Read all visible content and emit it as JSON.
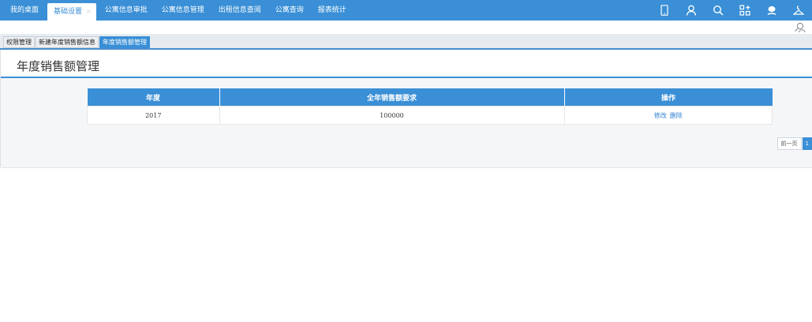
{
  "topnav": {
    "items": [
      {
        "label": "我的桌面"
      },
      {
        "label": "基础设置",
        "active": true,
        "close": "×"
      },
      {
        "label": "公寓信息审批"
      },
      {
        "label": "公寓信息管理"
      },
      {
        "label": "出租信息查阅"
      },
      {
        "label": "公寓查询"
      },
      {
        "label": "报表统计"
      }
    ],
    "icons": [
      "phone-icon",
      "user-icon",
      "search-icon",
      "apps-icon",
      "chat-icon",
      "hanger-icon"
    ]
  },
  "strip": {
    "icon": "search-person-icon"
  },
  "tabs": [
    {
      "label": "权限管理"
    },
    {
      "label": "新建年度销售额信息"
    },
    {
      "label": "年度销售额管理",
      "active": true
    }
  ],
  "panel": {
    "title": "年度销售额管理"
  },
  "table": {
    "headers": [
      "年度",
      "全年销售额要求",
      "操作"
    ],
    "rows": [
      {
        "year": "2017",
        "amount": "100000",
        "actions": [
          "修改",
          "删除"
        ]
      }
    ]
  },
  "pager": {
    "prev": "前一页",
    "current": "1"
  },
  "colors": {
    "primary": "#3a8fd6",
    "link": "#2f7fd1",
    "body_bg": "#f5f6f8"
  }
}
